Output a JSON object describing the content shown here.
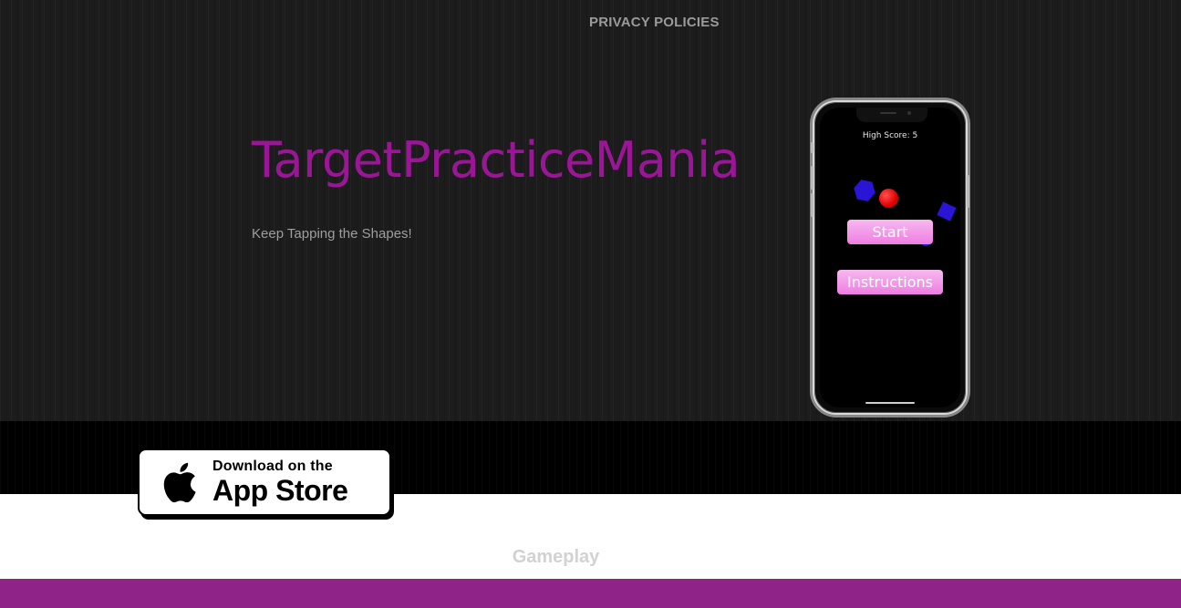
{
  "nav": {
    "privacy_link": "PRIVACY POLICIES"
  },
  "hero": {
    "title": "TargetPracticeMania",
    "tagline": "Keep Tapping the Shapes!"
  },
  "phone_screen": {
    "high_score": "High Score: 5",
    "start_button": "Start",
    "instructions_button": "Instructions"
  },
  "app_store_badge": {
    "line1": "Download on the",
    "line2": "App Store"
  },
  "gameplay_section": {
    "title": "Gameplay"
  },
  "colors": {
    "title_purple": "#9b1696",
    "band_purple": "#8f2387",
    "button_pink": "#ee7de3",
    "shape_blue": "#2a14d6",
    "ball_red": "#e00000"
  }
}
